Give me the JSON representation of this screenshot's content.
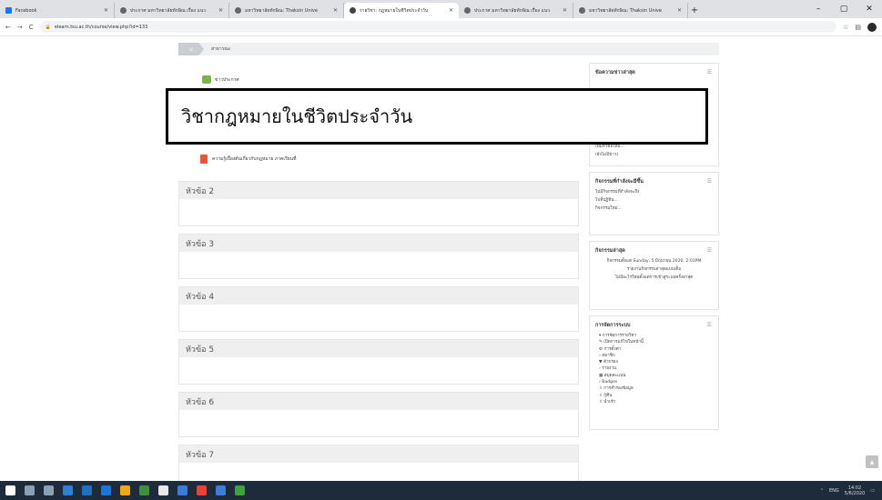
{
  "browser": {
    "tabs": [
      {
        "title": "Facebook",
        "favicon": "facebook-icon",
        "active": false
      },
      {
        "title": "ประกาศ มหาวิทยาลัยทักษิณ เรื่อง แนว",
        "favicon": "globe-icon",
        "active": false
      },
      {
        "title": "มหาวิทยาลัยทักษิณ: Thaksin Unive",
        "favicon": "globe-icon",
        "active": false
      },
      {
        "title": "รายวิชา: กฎหมายในชีวิตประจำวัน",
        "favicon": "user-icon",
        "active": true
      },
      {
        "title": "ประกาศ มหาวิทยาลัยทักษิณ เรื่อง แนว",
        "favicon": "globe-icon",
        "active": false
      },
      {
        "title": "มหาวิทยาลัยทักษิณ: Thaksin Unive",
        "favicon": "globe-icon",
        "active": false
      }
    ],
    "new_tab_label": "+",
    "window_controls": {
      "minimize": "–",
      "maximize": "▢",
      "close": "✕"
    },
    "nav": {
      "back": "←",
      "forward": "→",
      "reload": "C"
    },
    "url": "elearn.tsu.ac.th/course/view.php?id=133"
  },
  "breadcrumb": {
    "home": "⌂",
    "current": "สาธารณะ"
  },
  "course": {
    "news_forum": "ข่าวประกาศ",
    "overlay_title": "วิชากฎหมายในชีวิตประจำวัน",
    "file_resource": "ความรู้เบื้องต้นเกี่ยวกับกฎหมาย ภาคเรียนที่",
    "topics": [
      "หัวข้อ 2",
      "หัวข้อ 3",
      "หัวข้อ 4",
      "หัวข้อ 5",
      "หัวข้อ 6",
      "หัวข้อ 7"
    ]
  },
  "sidebar": {
    "news_block": {
      "title": "ข้อความข่าวล่าสุด",
      "line1": "เพิ่มหัวข้อใหม่...",
      "line2": "(ยังไม่มีข่าว)"
    },
    "upcoming_block": {
      "title": "กิจกรรมที่กำลังจะมีขึ้น",
      "line1": "ไม่มีกิจกรรมที่กำลังจะถึง",
      "line2": "ไปที่ปฏิทิน...",
      "line3": "กิจกรรมใหม่..."
    },
    "recent_block": {
      "title": "กิจกรรมล่าสุด",
      "line1": "กิจกรรมตั้งแต่ Sunday, 5 มิถุนายน 2020, 2:01PM",
      "line2": "รายงานกิจกรรมล่าสุดแบบเต็ม",
      "line3": "ไม่มีอะไรใหม่ตั้งแต่การเข้าสู่ระบบครั้งล่าสุด"
    },
    "admin_block": {
      "title": "การจัดการระบบ",
      "items": [
        "▾ การจัดการรายวิชา",
        "✎ เปิดการแก้ไขในหน้านี้",
        "⚙ การตั้งค่า",
        "› สมาชิก",
        "▼ ตัวกรอง",
        "› รายงาน",
        "▦ สมุดคะแนน",
        "› Badges",
        "⇧ การสำรองข้อมูล",
        "⇧ กู้คืน",
        "⇧ นำเข้า"
      ]
    }
  },
  "scroll_top_label": "▲",
  "taskbar": {
    "icon_colors": [
      "#ffffff",
      "#8aa0b4",
      "#8aa0b4",
      "#2f7fd6",
      "#1f6fc4",
      "#1976d2",
      "#f3a712",
      "#3f8f3f",
      "#e8e8e8",
      "#3a7bd5",
      "#ea4335",
      "#3c7ed8",
      "#3fa142"
    ],
    "clock_time": "14:02",
    "clock_date": "5/6/2020",
    "lang": "ENG"
  }
}
